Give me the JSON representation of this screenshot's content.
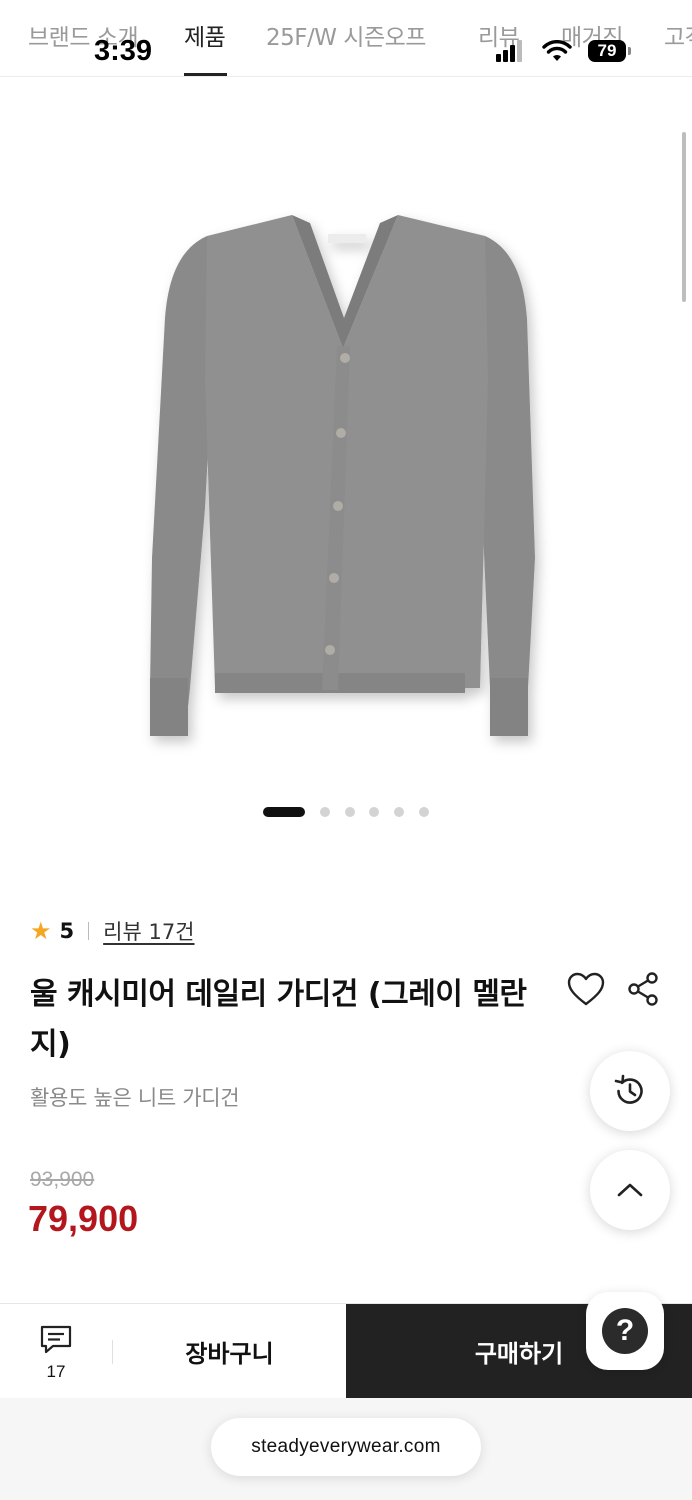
{
  "status_bar": {
    "time": "3:39",
    "battery": "79"
  },
  "nav": {
    "tabs": [
      {
        "label": "브랜드 소개",
        "active": false
      },
      {
        "label": "제품",
        "active": true
      },
      {
        "label": "25F/W 시즌오프",
        "active": false
      },
      {
        "label": "리뷰",
        "active": false
      },
      {
        "label": "매거진",
        "active": false
      },
      {
        "label": "고객",
        "active": false
      }
    ]
  },
  "carousel": {
    "total": 6,
    "current": 1
  },
  "product": {
    "rating_score": "5",
    "review_link": "리뷰 17건",
    "title": "울 캐시미어 데일리 가디건 (그레이 멜란지)",
    "subtitle": "활용도 높은 니트 가디건",
    "original_price": "93,900",
    "sale_price": "79,900",
    "sale_color": "#b3161c"
  },
  "bottom_bar": {
    "chat_count": "17",
    "cart_label": "장바구니",
    "buy_label": "구매하기"
  },
  "url": "steadyeverywear.com",
  "icons": {
    "like": "heart-icon",
    "share": "share-icon",
    "history": "history-icon",
    "top": "chevron-up-icon",
    "chat": "chat-icon",
    "help": "question-icon"
  }
}
